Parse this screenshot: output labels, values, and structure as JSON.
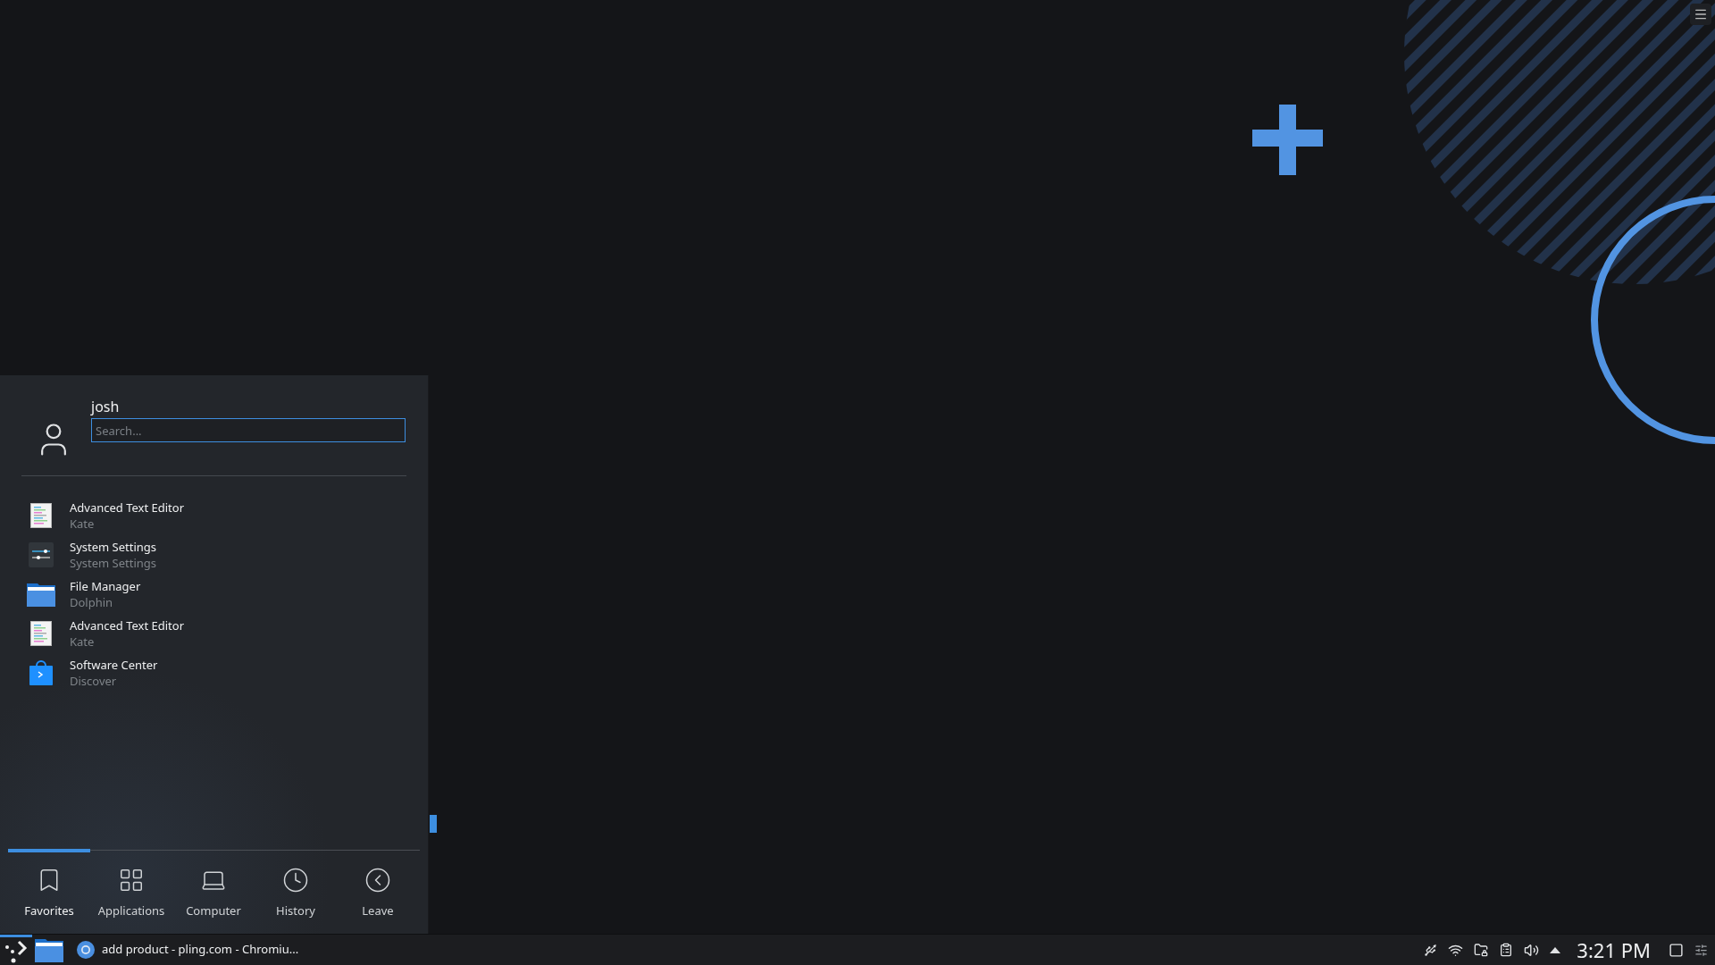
{
  "menu": {
    "user": {
      "name": "josh"
    },
    "search": {
      "placeholder": "Search..."
    },
    "apps": [
      {
        "kind": "document",
        "name": "Advanced Text Editor",
        "subtitle": "Kate"
      },
      {
        "kind": "sliders",
        "name": "System Settings",
        "subtitle": "System Settings"
      },
      {
        "kind": "folder",
        "name": "File Manager",
        "subtitle": "Dolphin"
      },
      {
        "kind": "document",
        "name": "Advanced Text Editor",
        "subtitle": "Kate"
      },
      {
        "kind": "bag",
        "name": "Software Center",
        "subtitle": "Discover"
      }
    ],
    "tabs": [
      {
        "kind": "bookmark",
        "label": "Favorites",
        "selected": true
      },
      {
        "kind": "grid",
        "label": "Applications",
        "selected": false
      },
      {
        "kind": "laptop",
        "label": "Computer",
        "selected": false
      },
      {
        "kind": "clock",
        "label": "History",
        "selected": false
      },
      {
        "kind": "back",
        "label": "Leave",
        "selected": false
      }
    ]
  },
  "taskbar": {
    "launcher": {
      "active": true
    },
    "tasks": [
      {
        "title": "add product - pling.com - Chromiu..."
      }
    ],
    "clock": "3:21 PM"
  }
}
